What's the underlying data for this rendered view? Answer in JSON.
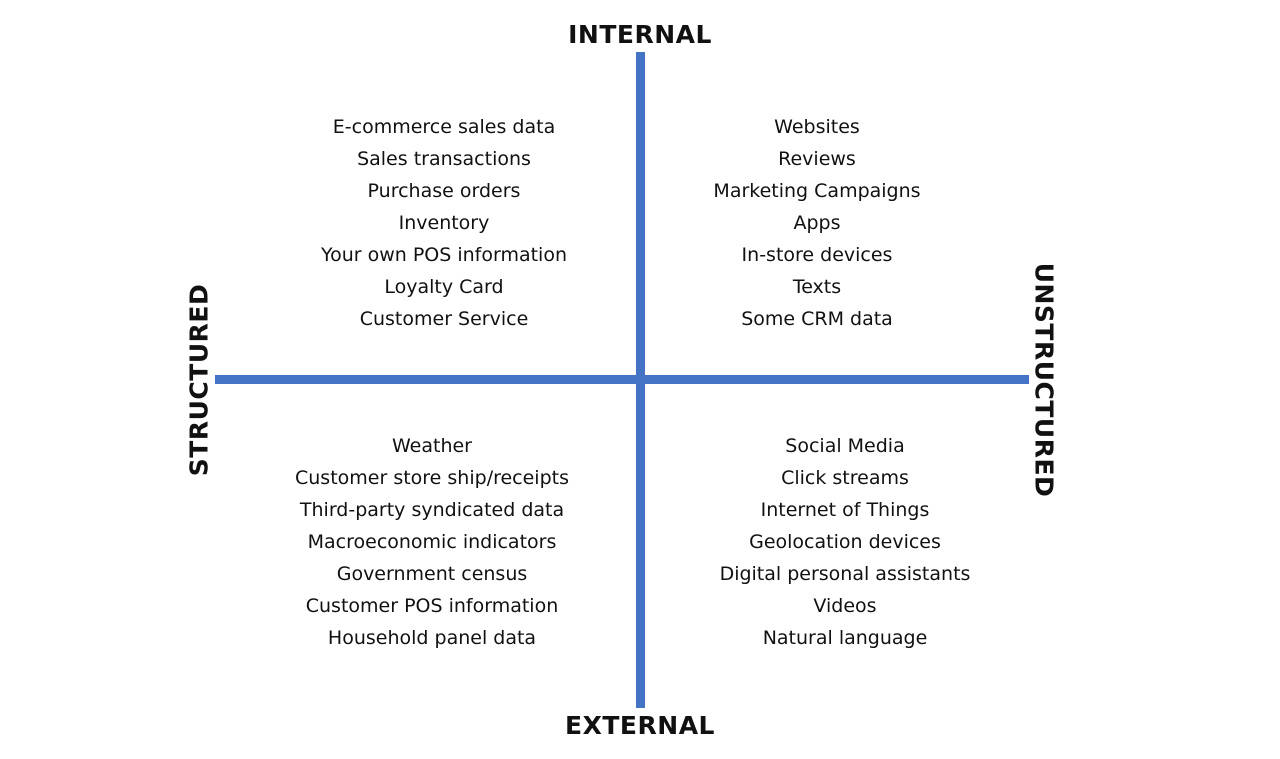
{
  "axis_color": "#4472C4",
  "axes": {
    "top": "INTERNAL",
    "bottom": "EXTERNAL",
    "left": "STRUCTURED",
    "right": "UNSTRUCTURED"
  },
  "quadrants": {
    "internal_structured": [
      "E-commerce sales data",
      "Sales transactions",
      "Purchase orders",
      "Inventory",
      "Your own POS information",
      "Loyalty Card",
      "Customer Service"
    ],
    "internal_unstructured": [
      "Websites",
      "Reviews",
      "Marketing Campaigns",
      "Apps",
      "In-store devices",
      "Texts",
      "Some CRM data"
    ],
    "external_structured": [
      "Weather",
      "Customer store ship/receipts",
      "Third-party syndicated data",
      "Macroeconomic indicators",
      "Government census",
      "Customer POS information",
      "Household panel data"
    ],
    "external_unstructured": [
      "Social Media",
      "Click streams",
      "Internet of Things",
      "Geolocation devices",
      "Digital personal assistants",
      "Videos",
      "Natural language"
    ]
  }
}
